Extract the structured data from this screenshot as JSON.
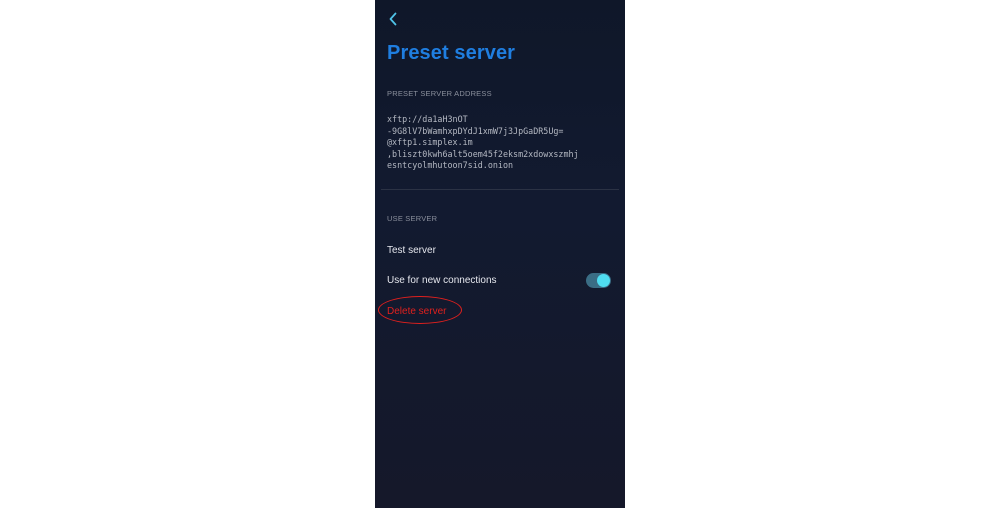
{
  "header": {
    "back_icon": "chevron-left-icon",
    "title": "Preset server"
  },
  "address_section": {
    "label": "PRESET SERVER ADDRESS",
    "lines": [
      "xftp://da1aH3nOT",
      "-9G8lV7bWamhxpDYdJ1xmW7j3JpGaDR5Ug=",
      "@xftp1.simplex.im",
      ",bliszt0kwh6alt5oem45f2eksm2xdowxszmhj",
      "esntcyolmhutoon7sid.onion"
    ]
  },
  "use_section": {
    "label": "USE SERVER",
    "test_server": "Test server",
    "use_new_connections": "Use for new connections",
    "use_new_connections_enabled": true,
    "delete_server": "Delete server"
  },
  "colors": {
    "accent": "#1f7ee0",
    "toggle_on": "#4fdcf0",
    "danger": "#e0201e"
  }
}
